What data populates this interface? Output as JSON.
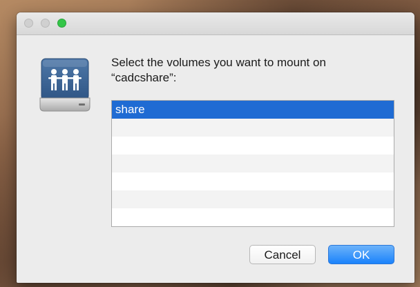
{
  "window": {
    "traffic_lights": {
      "close_color": "#d0d0d0",
      "minimize_color": "#d0d0d0",
      "zoom_color": "#34c648"
    }
  },
  "dialog": {
    "icon": "network-server-icon",
    "prompt_line1": "Select the volumes you want to mount on",
    "prompt_line2": "“cadcshare”:",
    "volumes": [
      {
        "label": "share",
        "selected": true
      },
      {
        "label": "",
        "selected": false
      },
      {
        "label": "",
        "selected": false
      },
      {
        "label": "",
        "selected": false
      },
      {
        "label": "",
        "selected": false
      },
      {
        "label": "",
        "selected": false
      },
      {
        "label": "",
        "selected": false
      }
    ],
    "cancel_label": "Cancel",
    "ok_label": "OK"
  },
  "colors": {
    "selection": "#1f6bd3",
    "default_button": "#1a82fb"
  }
}
